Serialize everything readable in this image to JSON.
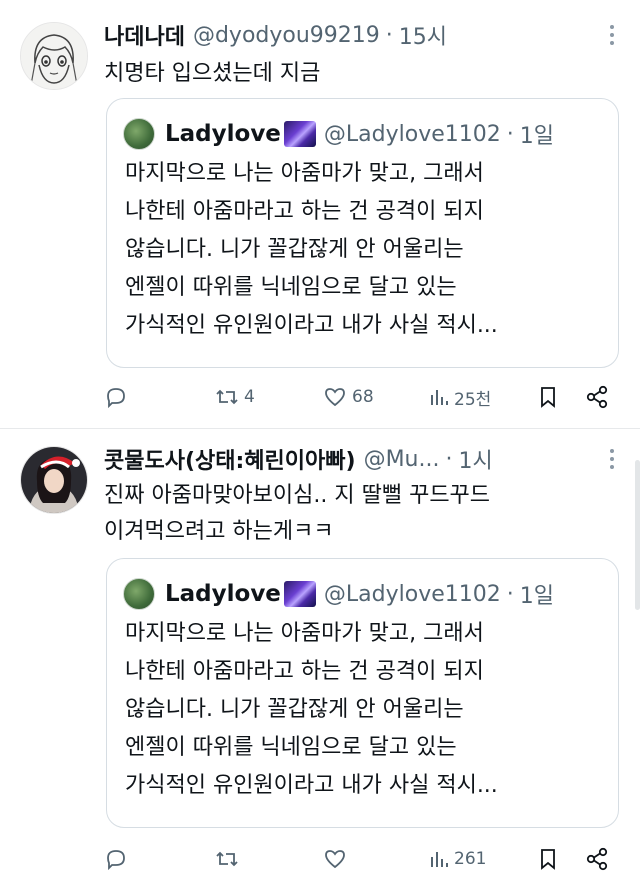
{
  "tweets": [
    {
      "name": "나데나데",
      "handle": "@dyodyou99219",
      "dot": "·",
      "time": "15시",
      "text": "치명타 입으셨는데 지금",
      "quote": {
        "name": "Ladylove",
        "handle": "@Ladylove1102",
        "dot": "·",
        "time": "1일",
        "lines": [
          "마지막으로 나는 아줌마가 맞고, 그래서",
          "나한테 아줌마라고 하는 건 공격이 되지",
          "않습니다. 니가 꼴갑잖게 안 어울리는",
          "엔젤이 따위를 닉네임으로 달고 있는",
          "가식적인 유인원이라고 내가 사실 적시..."
        ]
      },
      "actions": {
        "replies": "",
        "retweets": "4",
        "likes": "68",
        "views": "25천"
      }
    },
    {
      "name": "콧물도사(상태:혜린이아빠)",
      "handle": "@Mu...",
      "dot": "·",
      "time": "1시",
      "text_lines": [
        "진짜 아줌마맞아보이심.. 지 딸뻘 꾸드꾸드",
        "이겨먹으려고 하는게ㅋㅋ"
      ],
      "quote": {
        "name": "Ladylove",
        "handle": "@Ladylove1102",
        "dot": "·",
        "time": "1일",
        "lines": [
          "마지막으로 나는 아줌마가 맞고, 그래서",
          "나한테 아줌마라고 하는 건 공격이 되지",
          "않습니다. 니가 꼴갑잖게 안 어울리는",
          "엔젤이 따위를 닉네임으로 달고 있는",
          "가식적인 유인원이라고 내가 사실 적시..."
        ]
      },
      "actions": {
        "replies": "",
        "retweets": "",
        "likes": "",
        "views": "261"
      }
    }
  ],
  "icons": {
    "reply": "reply-icon",
    "retweet": "retweet-icon",
    "like": "heart-icon",
    "views": "views-icon",
    "bookmark": "bookmark-icon",
    "share": "share-icon",
    "more": "more-icon"
  },
  "colors": {
    "text": "#0f1419",
    "muted": "#536471",
    "border": "#d6dde3"
  }
}
